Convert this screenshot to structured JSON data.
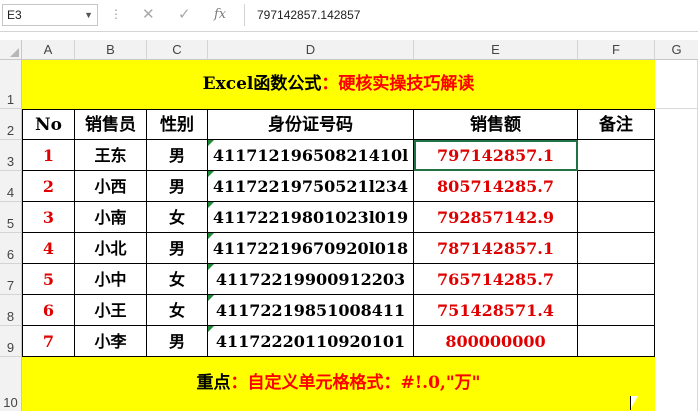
{
  "formula_bar": {
    "name_box": "E3",
    "cancel_glyph": "✕",
    "enter_glyph": "✓",
    "fx_glyph": "fx",
    "formula": "797142857.142857"
  },
  "columns": [
    "A",
    "B",
    "C",
    "D",
    "E",
    "F",
    "G"
  ],
  "rows": [
    "1",
    "2",
    "3",
    "4",
    "5",
    "6",
    "7",
    "8",
    "9",
    "10"
  ],
  "title": {
    "black": "Excel函数公式",
    "red": "：硬核实操技巧解读"
  },
  "table": {
    "headers": [
      "No",
      "销售员",
      "性别",
      "身份证号码",
      "销售额",
      "备注"
    ],
    "records": [
      {
        "no": "1",
        "name": "王东",
        "gender": "男",
        "id": "41171219650821410l",
        "sales": "797142857.1",
        "note": ""
      },
      {
        "no": "2",
        "name": "小西",
        "gender": "男",
        "id": "41172219750521l234",
        "sales": "805714285.7",
        "note": ""
      },
      {
        "no": "3",
        "name": "小南",
        "gender": "女",
        "id": "41172219801023l019",
        "sales": "792857142.9",
        "note": ""
      },
      {
        "no": "4",
        "name": "小北",
        "gender": "男",
        "id": "41172219670920l018",
        "sales": "787142857.1",
        "note": ""
      },
      {
        "no": "5",
        "name": "小中",
        "gender": "女",
        "id": "41172219900912203",
        "sales": "765714285.7",
        "note": ""
      },
      {
        "no": "6",
        "name": "小王",
        "gender": "女",
        "id": "41172219851008411",
        "sales": "751428571.4",
        "note": ""
      },
      {
        "no": "7",
        "name": "小李",
        "gender": "男",
        "id": "41172220110920101",
        "sales": "800000000",
        "note": ""
      }
    ]
  },
  "footer": {
    "black": "重点",
    "red": "：自定义单元格格式：#!.0,\"万\""
  },
  "colors": {
    "banner_bg": "#ffff00",
    "red_text": "#ff0000",
    "header_bg": "#f2f2f2"
  }
}
